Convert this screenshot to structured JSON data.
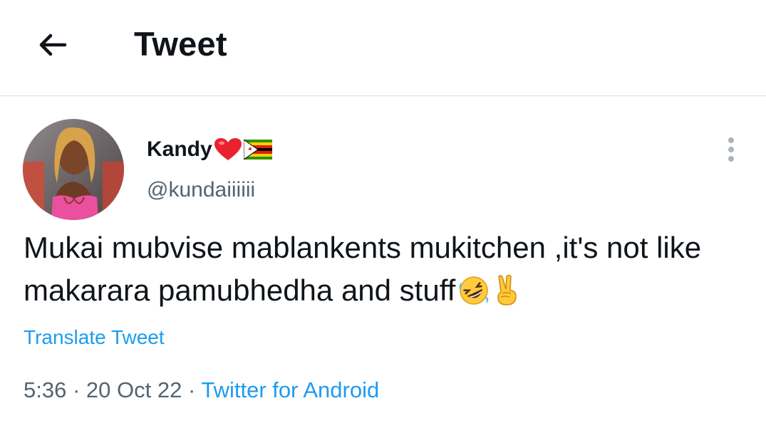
{
  "header": {
    "back_icon": "arrow-left-icon",
    "title": "Tweet"
  },
  "tweet": {
    "author": {
      "name": "Kandy",
      "name_emojis": [
        "red-heart-icon",
        "zimbabwe-flag-icon"
      ],
      "handle": "@kundaiiiiii",
      "avatar": "profile-photo"
    },
    "more_icon": "vertical-ellipsis-icon",
    "text": "Mukai mubvise mablankents mukitchen ,it's not like makarara pamubhedha and stuff",
    "text_emojis": [
      "rolling-on-floor-laughing-icon",
      "victory-hand-icon"
    ],
    "translate_label": "Translate Tweet",
    "time": "5:36",
    "separator": "·",
    "date": "20 Oct 22",
    "source": "Twitter for Android"
  },
  "colors": {
    "link": "#1d9bf0",
    "text": "#0f1419",
    "secondary": "#536471",
    "divider": "#dcdcdc"
  }
}
